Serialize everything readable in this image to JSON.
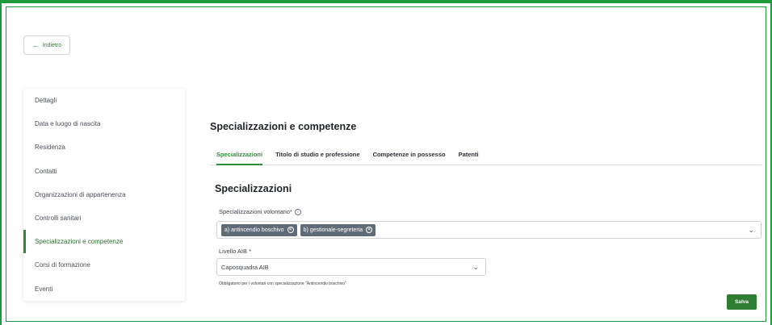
{
  "back_button": {
    "label": "Indietro",
    "icon": "arrow-left-icon"
  },
  "sidebar": {
    "items": [
      {
        "label": "Dettagli",
        "active": false
      },
      {
        "label": "Data e luogo di nascita",
        "active": false
      },
      {
        "label": "Residenza",
        "active": false
      },
      {
        "label": "Contatti",
        "active": false
      },
      {
        "label": "Organizzazioni di appartenenza",
        "active": false
      },
      {
        "label": "Controlli sanitari",
        "active": false
      },
      {
        "label": "Specializzazioni e competenze",
        "active": true
      },
      {
        "label": "Corsi di formazione",
        "active": false
      },
      {
        "label": "Eventi",
        "active": false
      }
    ]
  },
  "main": {
    "title": "Specializzazioni e competenze",
    "tabs": [
      {
        "label": "Specializzazioni",
        "active": true
      },
      {
        "label": "Titolo di studio e professione",
        "active": false
      },
      {
        "label": "Competenze in possesso",
        "active": false
      },
      {
        "label": "Patenti",
        "active": false
      }
    ],
    "section_title": "Specializzazioni",
    "specializzazioni_field": {
      "label": "Specializzazioni volontario*",
      "chips": [
        "a) antincendio boschivo",
        "b) gestionale-segreteria"
      ]
    },
    "livello_field": {
      "label": "Livello AIB *",
      "value": "Caposquadra AIB",
      "hint": "Obbligatorio per i volontari con specializzazione \"Antincendio boschivo\""
    },
    "save_label": "Salva"
  },
  "colors": {
    "accent": "#2e7d32",
    "frame": "#1e9a3c",
    "chip": "#5f6b76"
  }
}
